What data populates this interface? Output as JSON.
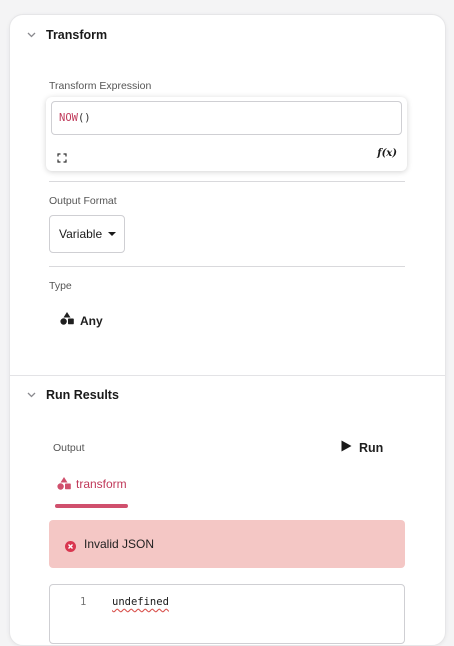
{
  "transform_section": {
    "title": "Transform",
    "expression_label": "Transform Expression",
    "expression": {
      "function_name": "NOW",
      "parens": "()"
    },
    "fx_label": "f(x)",
    "output_format_label": "Output Format",
    "output_format_value": "Variable",
    "type_label": "Type",
    "type_value": "Any"
  },
  "run_results_section": {
    "title": "Run Results",
    "output_label": "Output",
    "run_button_label": "Run",
    "tab_label": "transform",
    "error_message": "Invalid JSON",
    "code_lines": [
      {
        "number": "1",
        "text": "undefined"
      }
    ]
  },
  "colors": {
    "accent": "#c0395a",
    "error_bg": "#f4c7c5",
    "error_icon": "#d9364f"
  },
  "icons": {
    "collapse": "chevron-down-icon",
    "expand": "expand-icon",
    "fx": "function-icon",
    "type": "shapes-icon",
    "run": "play-icon",
    "error": "error-circle-icon"
  }
}
